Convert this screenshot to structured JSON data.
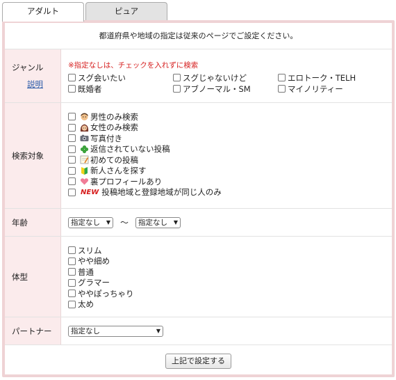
{
  "tabs": [
    {
      "label": "アダルト",
      "active": true
    },
    {
      "label": "ピュア",
      "active": false
    }
  ],
  "notice": "都道府県や地域の指定は従来のページでご設定ください。",
  "genre": {
    "label": "ジャンル",
    "help_link": "説明",
    "hint": "※指定なしは、チェックを入れずに検索",
    "options": [
      "スグ会いたい",
      "スグじゃないけど",
      "エロトーク・TELH",
      "既婚者",
      "アブノーマル・SM",
      "マイノリティー"
    ]
  },
  "search_target": {
    "label": "検索対象",
    "options": [
      {
        "icon": "man-face-icon",
        "label": "男性のみ検索"
      },
      {
        "icon": "woman-face-icon",
        "label": "女性のみ検索"
      },
      {
        "icon": "camera-icon",
        "label": "写真付き"
      },
      {
        "icon": "clover-icon",
        "label": "返信されていない投稿"
      },
      {
        "icon": "notepad-icon",
        "label": "初めての投稿"
      },
      {
        "icon": "beginner-mark-icon",
        "label": "新人さんを探す"
      },
      {
        "icon": "heart-icon",
        "label": "裏プロフィールあり"
      },
      {
        "icon": "new-badge",
        "badge": "NEW",
        "label": "投稿地域と登録地域が同じ人のみ"
      }
    ]
  },
  "age": {
    "label": "年齢",
    "from_value": "指定なし",
    "separator": "〜",
    "to_value": "指定なし"
  },
  "body_type": {
    "label": "体型",
    "options": [
      "スリム",
      "やや細め",
      "普通",
      "グラマー",
      "ややぽっちゃり",
      "太め"
    ]
  },
  "partner": {
    "label": "パートナー",
    "value": "指定なし"
  },
  "submit_label": "上記で設定する",
  "colors": {
    "frame": "#efd3d5",
    "label_bg": "#fbebec",
    "hint_red": "#d62020",
    "link_blue": "#2a5aa8"
  }
}
